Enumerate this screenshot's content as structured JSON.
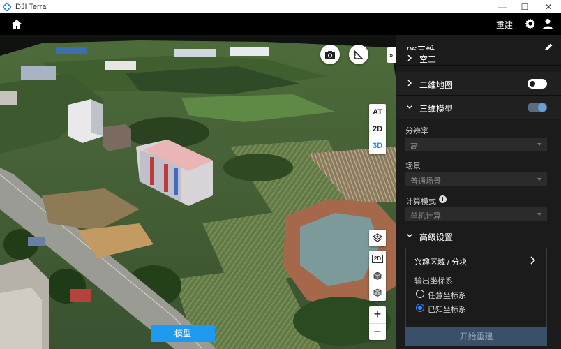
{
  "window": {
    "title": "DJI Terra",
    "controls": {
      "minimize": "—",
      "maximize": "☐",
      "close": "✕"
    }
  },
  "topbar": {
    "home_icon": "home-icon",
    "rebuild_label": "重建",
    "settings_icon": "gear-icon",
    "user_icon": "user-icon"
  },
  "viewer": {
    "camera_icon": "camera-icon",
    "measure_icon": "measure-icon",
    "collapse_glyph": "»",
    "view_modes": [
      "AT",
      "2D",
      "3D"
    ],
    "active_view_mode": "3D",
    "tool_2d_label": "2D",
    "mode_button_label": "模型",
    "zoom_in": "+",
    "zoom_out": "−"
  },
  "panel": {
    "mission_name": "06三维",
    "sections": {
      "aerial": {
        "label": "空三"
      },
      "map2d": {
        "label": "二维地图",
        "enabled": false
      },
      "model3d": {
        "label": "三维模型",
        "enabled": true
      }
    },
    "resolution": {
      "label": "分辨率",
      "value": "高"
    },
    "scene": {
      "label": "场景",
      "value": "普通场景"
    },
    "compute_mode": {
      "label": "计算模式",
      "value": "单机计算"
    },
    "advanced": {
      "label": "高级设置",
      "roi_label": "兴趣区域 / 分块",
      "output_crs_label": "输出坐标系",
      "crs_options": [
        "任意坐标系",
        "已知坐标系"
      ],
      "crs_selected": "已知坐标系"
    },
    "start_button_label": "开始重建"
  },
  "colors": {
    "accent_blue": "#1e9bf0",
    "panel_bg": "#1b1b1b",
    "start_button_bg": "#3a5068"
  }
}
